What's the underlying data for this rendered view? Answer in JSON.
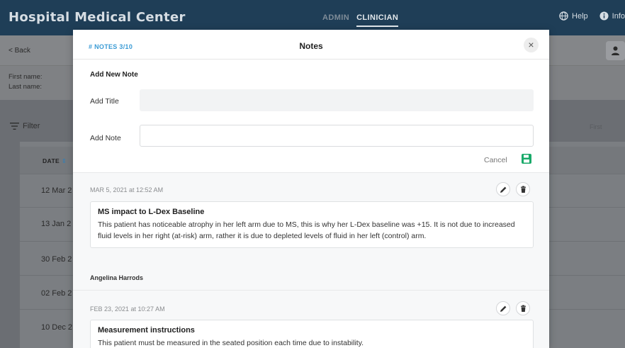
{
  "header": {
    "app_title": "Hospital Medical Center",
    "role_tabs": [
      {
        "label": "ADMIN",
        "active": false
      },
      {
        "label": "CLINICIAN",
        "active": true
      }
    ],
    "links": [
      {
        "label": "Help",
        "icon": "globe-icon"
      },
      {
        "label": "Info",
        "icon": "info-icon"
      }
    ]
  },
  "background": {
    "back_label": "< Back",
    "info_lines": [
      "First name:",
      "Last name:"
    ],
    "filter_label": "Filter",
    "sort_label": "First",
    "table": {
      "date_header": "DATE",
      "rows": [
        "12 Mar 2",
        "13 Jan 2",
        "30 Feb 2",
        "02 Feb 2",
        "10 Dec 2"
      ]
    }
  },
  "modal": {
    "notes_count": "# NOTES 3/10",
    "title": "Notes",
    "close_symbol": "×",
    "add_note": {
      "heading": "Add New Note",
      "title_label": "Add Title",
      "title_value": "",
      "note_label": "Add Note",
      "note_value": "",
      "cancel_label": "Cancel"
    },
    "notes": [
      {
        "timestamp": "MAR 5, 2021 at 12:52 AM",
        "title": "MS impact to L-Dex Baseline",
        "text": "This patient has noticeable atrophy in her left arm due to MS, this is why her L-Dex baseline was +15. It is not due to increased fluid levels in her right (at-risk) arm, rather it is due to depleted levels of fluid in her left (control) arm.",
        "author": "Angelina Harrods"
      },
      {
        "timestamp": "FEB 23, 2021 at 10:27 AM",
        "title": "Measurement instructions",
        "text": "This patient must be measured in the seated position each time due to instability."
      }
    ]
  },
  "colors": {
    "header_bg": "#1f3e57",
    "accent_blue": "#3a9bd5",
    "save_green": "#1aaa6a"
  }
}
